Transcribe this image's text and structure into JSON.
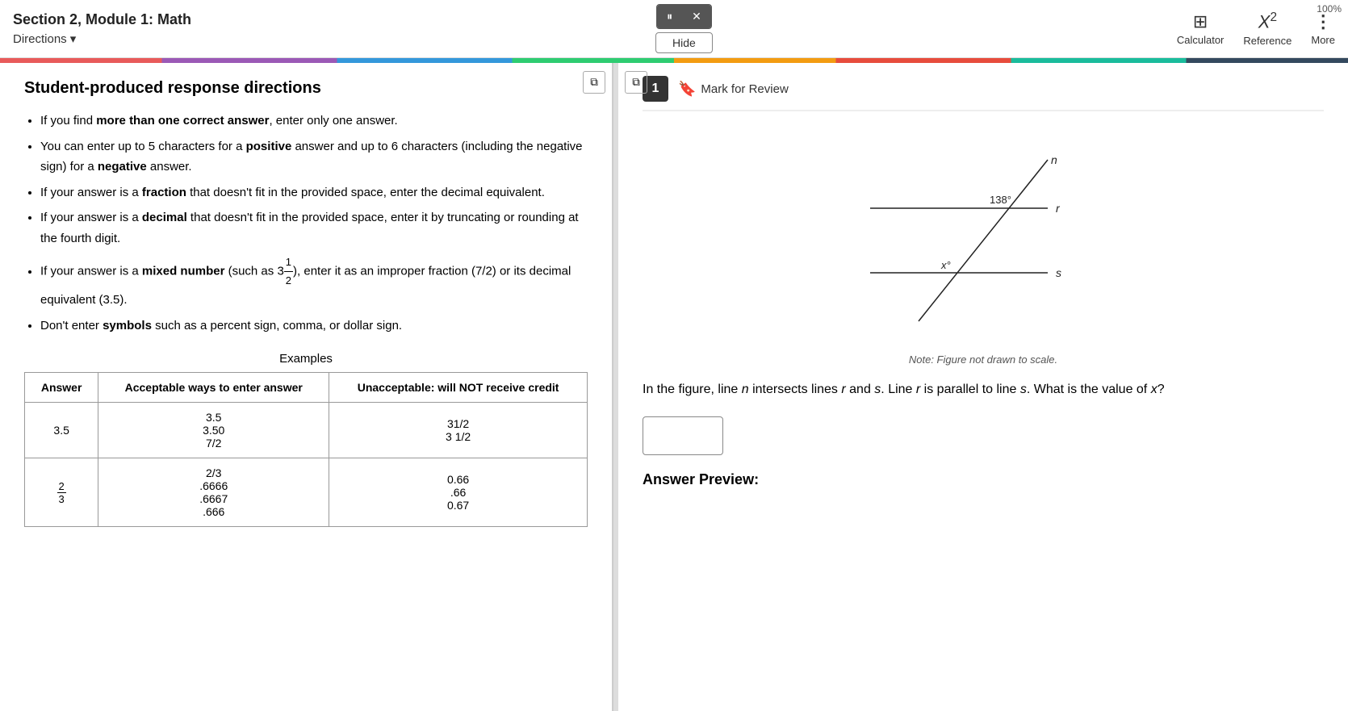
{
  "header": {
    "title": "Section 2, Module 1: Math",
    "directions_label": "Directions",
    "hide_label": "Hide",
    "zoom_level": "100%",
    "calculator_label": "Calculator",
    "reference_label": "Reference",
    "more_label": "More"
  },
  "left_panel": {
    "heading": "Student-produced response directions",
    "bullets": [
      {
        "text_parts": [
          {
            "text": "If you find ",
            "bold": false
          },
          {
            "text": "more than one correct answer",
            "bold": true
          },
          {
            "text": ", enter only one answer.",
            "bold": false
          }
        ]
      },
      {
        "text_parts": [
          {
            "text": "You can enter up to 5 characters for a ",
            "bold": false
          },
          {
            "text": "positive",
            "bold": true
          },
          {
            "text": " answer and up to 6 characters (including the negative sign) for a ",
            "bold": false
          },
          {
            "text": "negative",
            "bold": true
          },
          {
            "text": " answer.",
            "bold": false
          }
        ]
      },
      {
        "text_parts": [
          {
            "text": "If your answer is a ",
            "bold": false
          },
          {
            "text": "fraction",
            "bold": true
          },
          {
            "text": " that doesn't fit in the provided space, enter the decimal equivalent.",
            "bold": false
          }
        ]
      },
      {
        "text_parts": [
          {
            "text": "If your answer is a ",
            "bold": false
          },
          {
            "text": "decimal",
            "bold": true
          },
          {
            "text": " that doesn't fit in the provided space, enter it by truncating or rounding at the fourth digit.",
            "bold": false
          }
        ]
      },
      {
        "text_parts": [
          {
            "text": "If your answer is a ",
            "bold": false
          },
          {
            "text": "mixed number",
            "bold": true
          },
          {
            "text": " (such as 3½), enter it as an improper fraction (7/2) or its decimal equivalent (3.5).",
            "bold": false
          }
        ]
      },
      {
        "text_parts": [
          {
            "text": "Don't enter ",
            "bold": false
          },
          {
            "text": "symbols",
            "bold": true
          },
          {
            "text": " such as a percent sign, comma, or dollar sign.",
            "bold": false
          }
        ]
      }
    ],
    "examples_title": "Examples",
    "table": {
      "headers": [
        "Answer",
        "Acceptable ways to enter answer",
        "Unacceptable: will NOT receive credit"
      ],
      "rows": [
        {
          "answer": "3.5",
          "acceptable": "3.5\n3.50\n7/2",
          "unacceptable": "31/2\n3 1/2"
        },
        {
          "answer": "2/3",
          "acceptable": "2/3\n.6666\n.6667\n.666",
          "unacceptable": "0.66\n.66\n0.67"
        }
      ]
    }
  },
  "right_panel": {
    "question_number": "1",
    "mark_review_label": "Mark for Review",
    "figure_note": "Note: Figure not drawn to scale.",
    "question_text": "In the figure, line n intersects lines r and s. Line r is parallel to line s. What is the value of x?",
    "angle_label": "138°",
    "line_labels": {
      "n": "n",
      "r": "r",
      "s": "s",
      "x": "x°"
    },
    "answer_preview_label": "Answer Preview:",
    "answer_placeholder": ""
  },
  "toolbar": {
    "pause_icon": "⏸",
    "close_icon": "✕",
    "collapse_left_icon": "⧉",
    "collapse_right_icon": "⧉",
    "bookmark_icon": "🔖",
    "chevron_down": "▾",
    "calculator_icon": "▦",
    "more_icon": "⋮"
  }
}
